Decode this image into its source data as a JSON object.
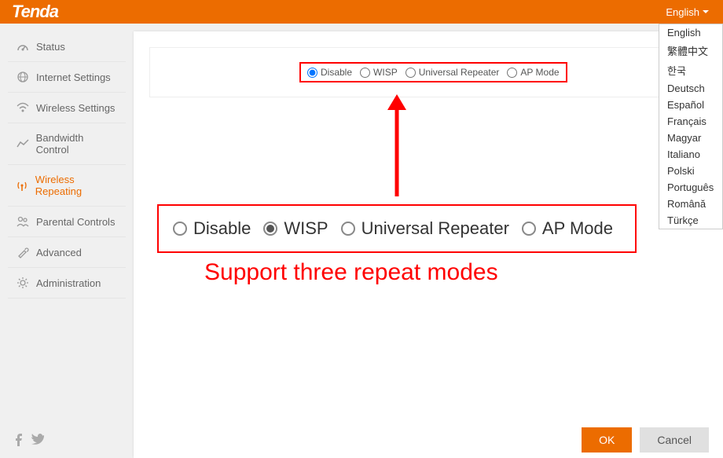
{
  "header": {
    "brand": "Tenda",
    "lang_label": "English"
  },
  "languages": [
    "English",
    "繁體中文",
    "한국",
    "Deutsch",
    "Español",
    "Français",
    "Magyar",
    "Italiano",
    "Polski",
    "Português",
    "Română",
    "Türkçe"
  ],
  "sidebar": {
    "items": [
      {
        "label": "Status"
      },
      {
        "label": "Internet Settings"
      },
      {
        "label": "Wireless Settings"
      },
      {
        "label": "Bandwidth Control"
      },
      {
        "label": "Wireless Repeating"
      },
      {
        "label": "Parental Controls"
      },
      {
        "label": "Advanced"
      },
      {
        "label": "Administration"
      }
    ]
  },
  "modes": {
    "disable": "Disable",
    "wisp": "WISP",
    "universal": "Universal Repeater",
    "ap": "AP Mode"
  },
  "zoom": {
    "disable": "Disable",
    "wisp": "WISP",
    "universal": "Universal Repeater",
    "ap": "AP Mode"
  },
  "caption": "Support three repeat modes",
  "buttons": {
    "ok": "OK",
    "cancel": "Cancel"
  }
}
